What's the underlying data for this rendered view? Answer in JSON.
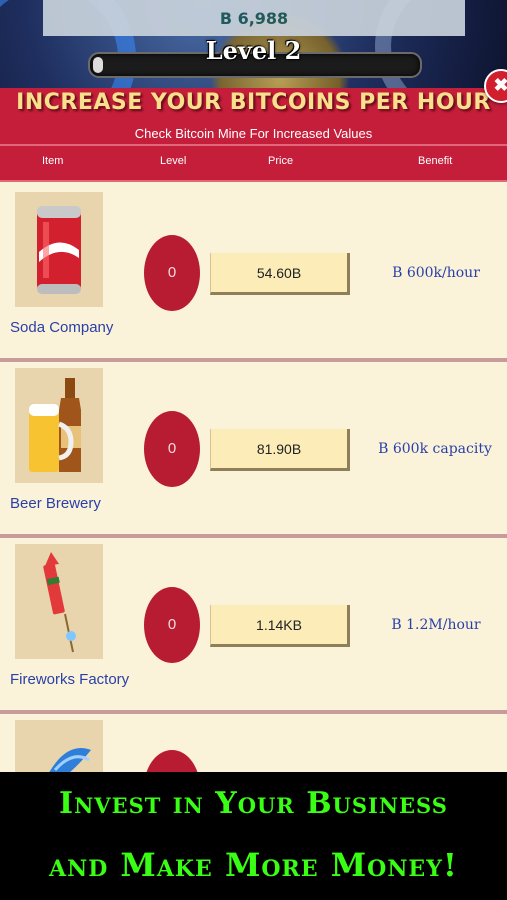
{
  "hud": {
    "balance": "B 6,988",
    "level_label": "Level 2",
    "level_progress": 0.02
  },
  "store": {
    "title": "INCREASE YOUR BITCOINS PER HOUR",
    "subtitle": "Check Bitcoin Mine For Increased Values",
    "columns": [
      "Item",
      "Level",
      "Price",
      "Benefit"
    ],
    "items": [
      {
        "name": "Soda Company",
        "level": "0",
        "price": "54.60B",
        "benefit": "B 600k/hour",
        "icon": "soda-can-icon"
      },
      {
        "name": "Beer Brewery",
        "level": "0",
        "price": "81.90B",
        "benefit": "B 600k capacity",
        "icon": "beer-icon"
      },
      {
        "name": "Fireworks Factory",
        "level": "0",
        "price": "1.14KB",
        "benefit": "B 1.2M/hour",
        "icon": "firework-rocket-icon"
      },
      {
        "name": "",
        "level": "",
        "price": "",
        "benefit": "",
        "icon": "blue-item-icon"
      }
    ]
  },
  "promo": {
    "line1": "Invest in Your Business",
    "line2": "and Make More Money!"
  },
  "colors": {
    "header_red": "#c41e3a",
    "list_bg": "#fbf3d9",
    "promo_green": "#39ff14"
  }
}
